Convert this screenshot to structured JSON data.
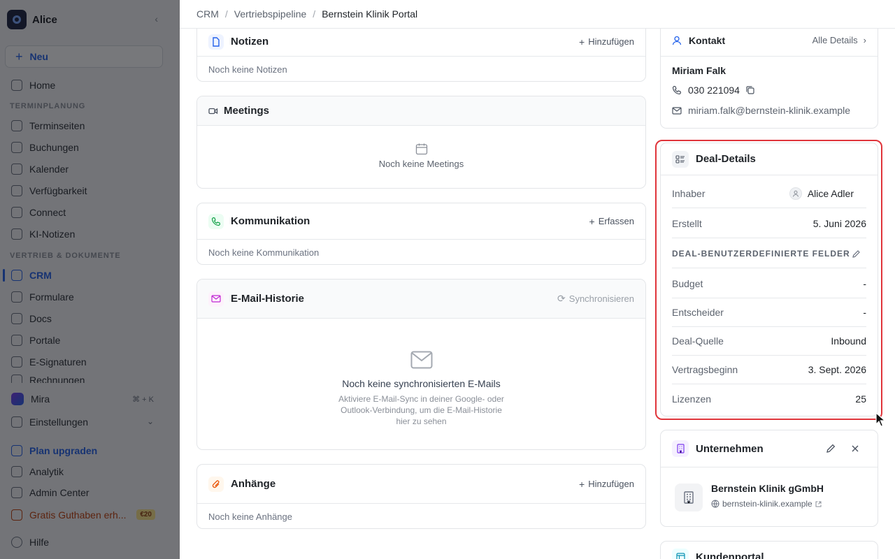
{
  "sidebar": {
    "workspace": "Alice",
    "new_label": "Neu",
    "home": "Home",
    "section_scheduling": "TERMINPLANUNG",
    "scheduling": [
      "Terminseiten",
      "Buchungen",
      "Kalender",
      "Verfügbarkeit",
      "Connect",
      "KI-Notizen"
    ],
    "section_sales": "VERTRIEB & DOKUMENTE",
    "sales": [
      "CRM",
      "Formulare",
      "Docs",
      "Portale",
      "E-Signaturen",
      "Rechnungen"
    ],
    "mira": "Mira",
    "mira_shortcut": "⌘ + K",
    "settings": "Einstellungen",
    "upgrade": "Plan upgraden",
    "analytics": "Analytik",
    "admin": "Admin Center",
    "credit": "Gratis Guthaben erh...",
    "credit_badge": "€20",
    "help": "Hilfe"
  },
  "breadcrumb": {
    "items": [
      "CRM",
      "Vertriebspipeline"
    ],
    "current": "Bernstein Klinik Portal"
  },
  "notes": {
    "title": "Notizen",
    "action": "Hinzufügen",
    "empty": "Noch keine Notizen"
  },
  "meetings": {
    "title": "Meetings",
    "empty": "Noch keine Meetings"
  },
  "communication": {
    "title": "Kommunikation",
    "action": "Erfassen",
    "empty": "Noch keine Kommunikation"
  },
  "email_history": {
    "title": "E-Mail-Historie",
    "action": "Synchronisieren",
    "empty_title": "Noch keine synchronisierten E-Mails",
    "empty_sub": "Aktiviere E-Mail-Sync in deiner Google- oder Outlook-Verbindung, um die E-Mail-Historie hier zu sehen"
  },
  "attachments": {
    "title": "Anhänge",
    "action": "Hinzufügen",
    "empty": "Noch keine Anhänge"
  },
  "contact": {
    "title": "Kontakt",
    "all_details": "Alle Details",
    "name": "Miriam Falk",
    "phone": "030 221094",
    "email": "miriam.falk@bernstein-klinik.example"
  },
  "deal": {
    "title": "Deal-Details",
    "owner_label": "Inhaber",
    "owner": "Alice Adler",
    "created_label": "Erstellt",
    "created": "5. Juni 2026",
    "custom_section": "DEAL-BENUTZERDEFINIERTE FELDER",
    "budget_label": "Budget",
    "budget": "-",
    "decider_label": "Entscheider",
    "decider": "-",
    "source_label": "Deal-Quelle",
    "source": "Inbound",
    "contract_label": "Vertragsbeginn",
    "contract": "3. Sept. 2026",
    "licenses_label": "Lizenzen",
    "licenses": "25"
  },
  "company": {
    "title": "Unternehmen",
    "name": "Bernstein Klinik gGmbH",
    "domain": "bernstein-klinik.example"
  },
  "portal": {
    "title": "Kundenportal"
  },
  "colors": {
    "accent": "#2563eb",
    "highlight": "#e0353b",
    "overlay": "rgba(12,14,20,0.56)"
  }
}
